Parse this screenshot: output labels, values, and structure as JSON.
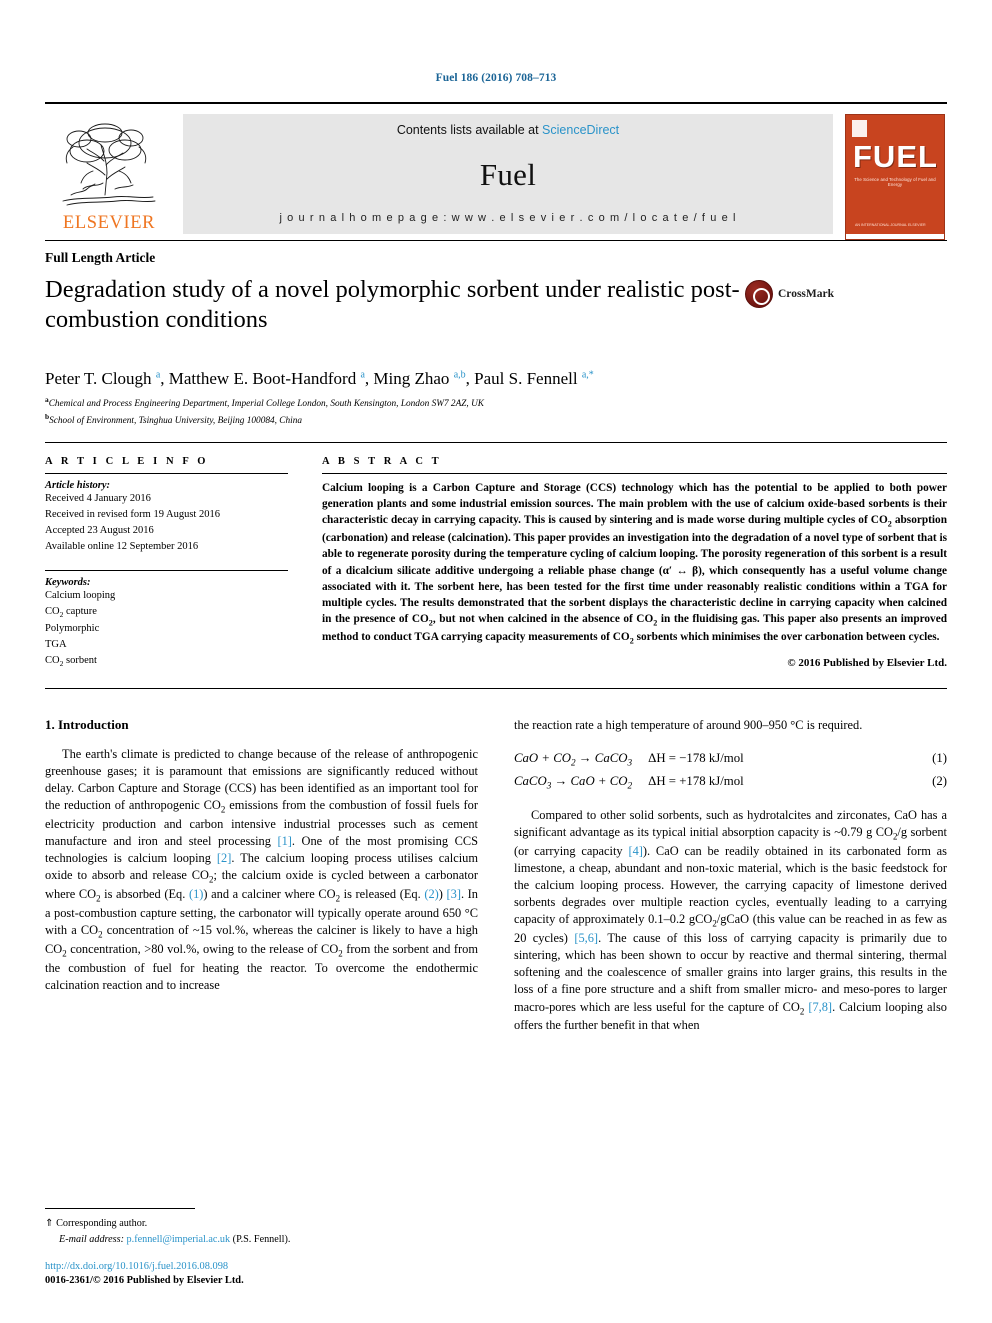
{
  "running_head": "Fuel 186 (2016) 708–713",
  "masthead": {
    "publisher_name": "ELSEVIER",
    "contents_prefix": "Contents lists available at ",
    "contents_link": "ScienceDirect",
    "journal_title": "Fuel",
    "homepage": "j o u r n a l   h o m e p a g e :   w w w . e l s e v i e r . c o m / l o c a t e / f u e l",
    "cover": {
      "title": "FUEL",
      "subtitle": "The Science and Technology of Fuel and Energy",
      "footer": "AN INTERNATIONAL JOURNAL\nELSEVIER"
    }
  },
  "article": {
    "type": "Full Length Article",
    "title": "Degradation study of a novel polymorphic sorbent under realistic post-combustion conditions",
    "crossmark_label": "CrossMark",
    "authors_html": "Peter T. Clough <sup>a</sup>, Matthew E. Boot-Handford <sup>a</sup>, Ming Zhao <sup>a,b</sup>, Paul S. Fennell <sup>a,*</sup>",
    "affiliations": [
      {
        "marker": "a",
        "text": "Chemical and Process Engineering Department, Imperial College London, South Kensington, London SW7 2AZ, UK"
      },
      {
        "marker": "b",
        "text": "School of Environment, Tsinghua University, Beijing 100084, China"
      }
    ]
  },
  "info": {
    "heading": "A R T I C L E   I N F O",
    "history_label": "Article history:",
    "history": [
      "Received 4 January 2016",
      "Received in revised form 19 August 2016",
      "Accepted 23 August 2016",
      "Available online 12 September 2016"
    ],
    "keywords_label": "Keywords:",
    "keywords_html": [
      "Calcium looping",
      "CO<sub>2</sub> capture",
      "Polymorphic",
      "TGA",
      "CO<sub>2</sub> sorbent"
    ]
  },
  "abstract": {
    "heading": "A B S T R A C T",
    "text_html": "Calcium looping is a Carbon Capture and Storage (CCS) technology which has the potential to be applied to both power generation plants and some industrial emission sources. The main problem with the use of calcium oxide-based sorbents is their characteristic decay in carrying capacity. This is caused by sintering and is made worse during multiple cycles of CO<sub>2</sub> absorption (carbonation) and release (calcination). This paper provides an investigation into the degradation of a novel type of sorbent that is able to regenerate porosity during the temperature cycling of calcium looping. The porosity regeneration of this sorbent is a result of a dicalcium silicate additive undergoing a reliable phase change (&alpha;&prime; &harr; &beta;), which consequently has a useful volume change associated with it. The sorbent here, has been tested for the first time under reasonably realistic conditions within a TGA for multiple cycles. The results demonstrated that the sorbent displays the characteristic decline in carrying capacity when calcined in the presence of CO<sub>2</sub>, but not when calcined in the absence of CO<sub>2</sub> in the fluidising gas. This paper also presents an improved method to conduct TGA carrying capacity measurements of CO<sub>2</sub> sorbents which minimises the over carbonation between cycles.",
    "copyright": "© 2016 Published by Elsevier Ltd."
  },
  "body": {
    "section_heading": "1. Introduction",
    "left_paragraph_html": "The earth's climate is predicted to change because of the release of anthropogenic greenhouse gases; it is paramount that emissions are significantly reduced without delay. Carbon Capture and Storage (CCS) has been identified as an important tool for the reduction of anthropogenic CO<sub>2</sub> emissions from the combustion of fossil fuels for electricity production and carbon intensive industrial processes such as cement manufacture and iron and steel processing <span class=\"ref\">[1]</span>. One of the most promising CCS technologies is calcium looping <span class=\"ref\">[2]</span>. The calcium looping process utilises calcium oxide to absorb and release CO<sub>2</sub>; the calcium oxide is cycled between a carbonator where CO<sub>2</sub> is absorbed (Eq. <span class=\"ref\">(1)</span>) and a calciner where CO<sub>2</sub> is released (Eq. <span class=\"ref\">(2)</span>) <span class=\"ref\">[3]</span>. In a post-combustion capture setting, the carbonator will typically operate around 650 °C with a CO<sub>2</sub> concentration of ~15 vol.%, whereas the calciner is likely to have a high CO<sub>2</sub> concentration, &gt;80 vol.%, owing to the release of CO<sub>2</sub> from the sorbent and from the combustion of fuel for heating the reactor. To overcome the endothermic calcination reaction and to increase",
    "right_lead_html": "the reaction rate a high temperature of around 900–950 °C is required.",
    "equations": [
      {
        "formula_html": "CaO + CO<sub>2</sub> &rarr; CaCO<sub>3</sub>",
        "enthalpy": "ΔH = −178 kJ/mol",
        "number": "(1)"
      },
      {
        "formula_html": "CaCO<sub>3</sub> &rarr; CaO + CO<sub>2</sub>",
        "enthalpy": "ΔH = +178 kJ/mol",
        "number": "(2)"
      }
    ],
    "right_paragraph_html": "Compared to other solid sorbents, such as hydrotalcites and zirconates, CaO has a significant advantage as its typical initial absorption capacity is ~0.79 g CO<sub>2</sub>/g sorbent (or carrying capacity <span class=\"ref\">[4]</span>). CaO can be readily obtained in its carbonated form as limestone, a cheap, abundant and non-toxic material, which is the basic feedstock for the calcium looping process. However, the carrying capacity of limestone derived sorbents degrades over multiple reaction cycles, eventually leading to a carrying capacity of approximately 0.1–0.2 gCO<sub>2</sub>/gCaO (this value can be reached in as few as 20 cycles) <span class=\"ref\">[5,6]</span>. The cause of this loss of carrying capacity is primarily due to sintering, which has been shown to occur by reactive and thermal sintering, thermal softening and the coalescence of smaller grains into larger grains, this results in the loss of a fine pore structure and a shift from smaller micro- and meso-pores to larger macro-pores which are less useful for the capture of CO<sub>2</sub> <span class=\"ref\">[7,8]</span>. Calcium looping also offers the further benefit in that when"
  },
  "footnote": {
    "corresponding_marker": "⇑",
    "corresponding_text": "Corresponding author.",
    "email_label": "E-mail address:",
    "email": "p.fennell@imperial.ac.uk",
    "email_owner": "(P.S. Fennell).",
    "doi": "http://dx.doi.org/10.1016/j.fuel.2016.08.098",
    "issn": "0016-2361/© 2016 Published by Elsevier Ltd."
  },
  "colors": {
    "link_blue": "#2a93c9",
    "running_head_blue": "#1a6496",
    "elsevier_orange": "#ef7622",
    "cover_red": "#c8441f",
    "banner_gray": "#e6e6e6"
  }
}
